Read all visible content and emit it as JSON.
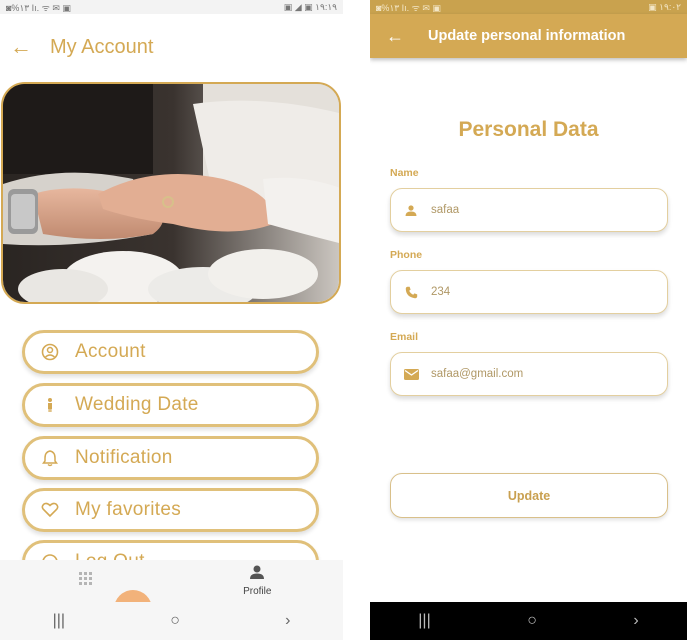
{
  "left": {
    "status": {
      "left": "◙%١٣ Iı. ᯤ ✉ ▣",
      "right": "▣ ◢ ▣ ١٩:١٩"
    },
    "header": {
      "back_icon": "arrow-left-icon",
      "title": "My Account"
    },
    "menu": [
      {
        "icon": "account-circle-icon",
        "label": "Account"
      },
      {
        "icon": "person-standing-icon",
        "label": "Wedding Date"
      },
      {
        "icon": "bell-icon",
        "label": "Notification"
      },
      {
        "icon": "heart-icon",
        "label": "My favorites"
      },
      {
        "icon": "logout-icon",
        "label": "Log Out"
      }
    ],
    "bottom_nav": {
      "profile_label": "Profile"
    },
    "accent": "#d4a954"
  },
  "right": {
    "status": {
      "left": "◙%١٣ Iı. ᯤ ✉ ▣",
      "right": "▣ ١٩:٠٢"
    },
    "appbar": {
      "back_icon": "arrow-left-icon",
      "title": "Update personal information"
    },
    "heading": "Personal Data",
    "fields": {
      "name": {
        "label": "Name",
        "value": "safaa",
        "icon": "person-icon"
      },
      "phone": {
        "label": "Phone",
        "value": "234",
        "icon": "phone-icon"
      },
      "email": {
        "label": "Email",
        "value": "safaa@gmail.com",
        "icon": "mail-icon"
      }
    },
    "update_label": "Update"
  }
}
